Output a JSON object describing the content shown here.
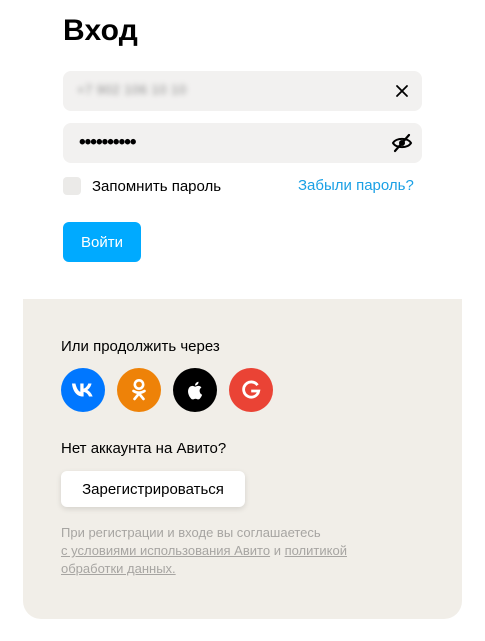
{
  "title": "Вход",
  "phone_field": {
    "value": "+7 902 106 10 10"
  },
  "password_field": {
    "value": "••••••••••"
  },
  "remember": {
    "label": "Запомнить пароль"
  },
  "forgot": {
    "label": "Забыли пароль?"
  },
  "login_button": {
    "label": "Войти"
  },
  "continue": {
    "label": "Или продолжить через"
  },
  "socials": [
    "vk-icon",
    "ok-icon",
    "apple-icon",
    "google-icon"
  ],
  "no_account": {
    "label": "Нет аккаунта на Авито?"
  },
  "register_button": {
    "label": "Зарегистрироваться"
  },
  "terms": {
    "text_start": "При регистрации и входе вы соглашаетесь",
    "link_terms": "с условиями использования Авито",
    "and": "и",
    "link_policy": "политикой обработки данных."
  },
  "colors": {
    "accent": "#00aaff",
    "link": "#1aa0e5",
    "vk": "#0077ff",
    "ok": "#ee8208",
    "apple": "#000000",
    "google": "#ea4335",
    "bottom_panel": "#f1eee8",
    "field_bg": "#f2f1f0"
  }
}
